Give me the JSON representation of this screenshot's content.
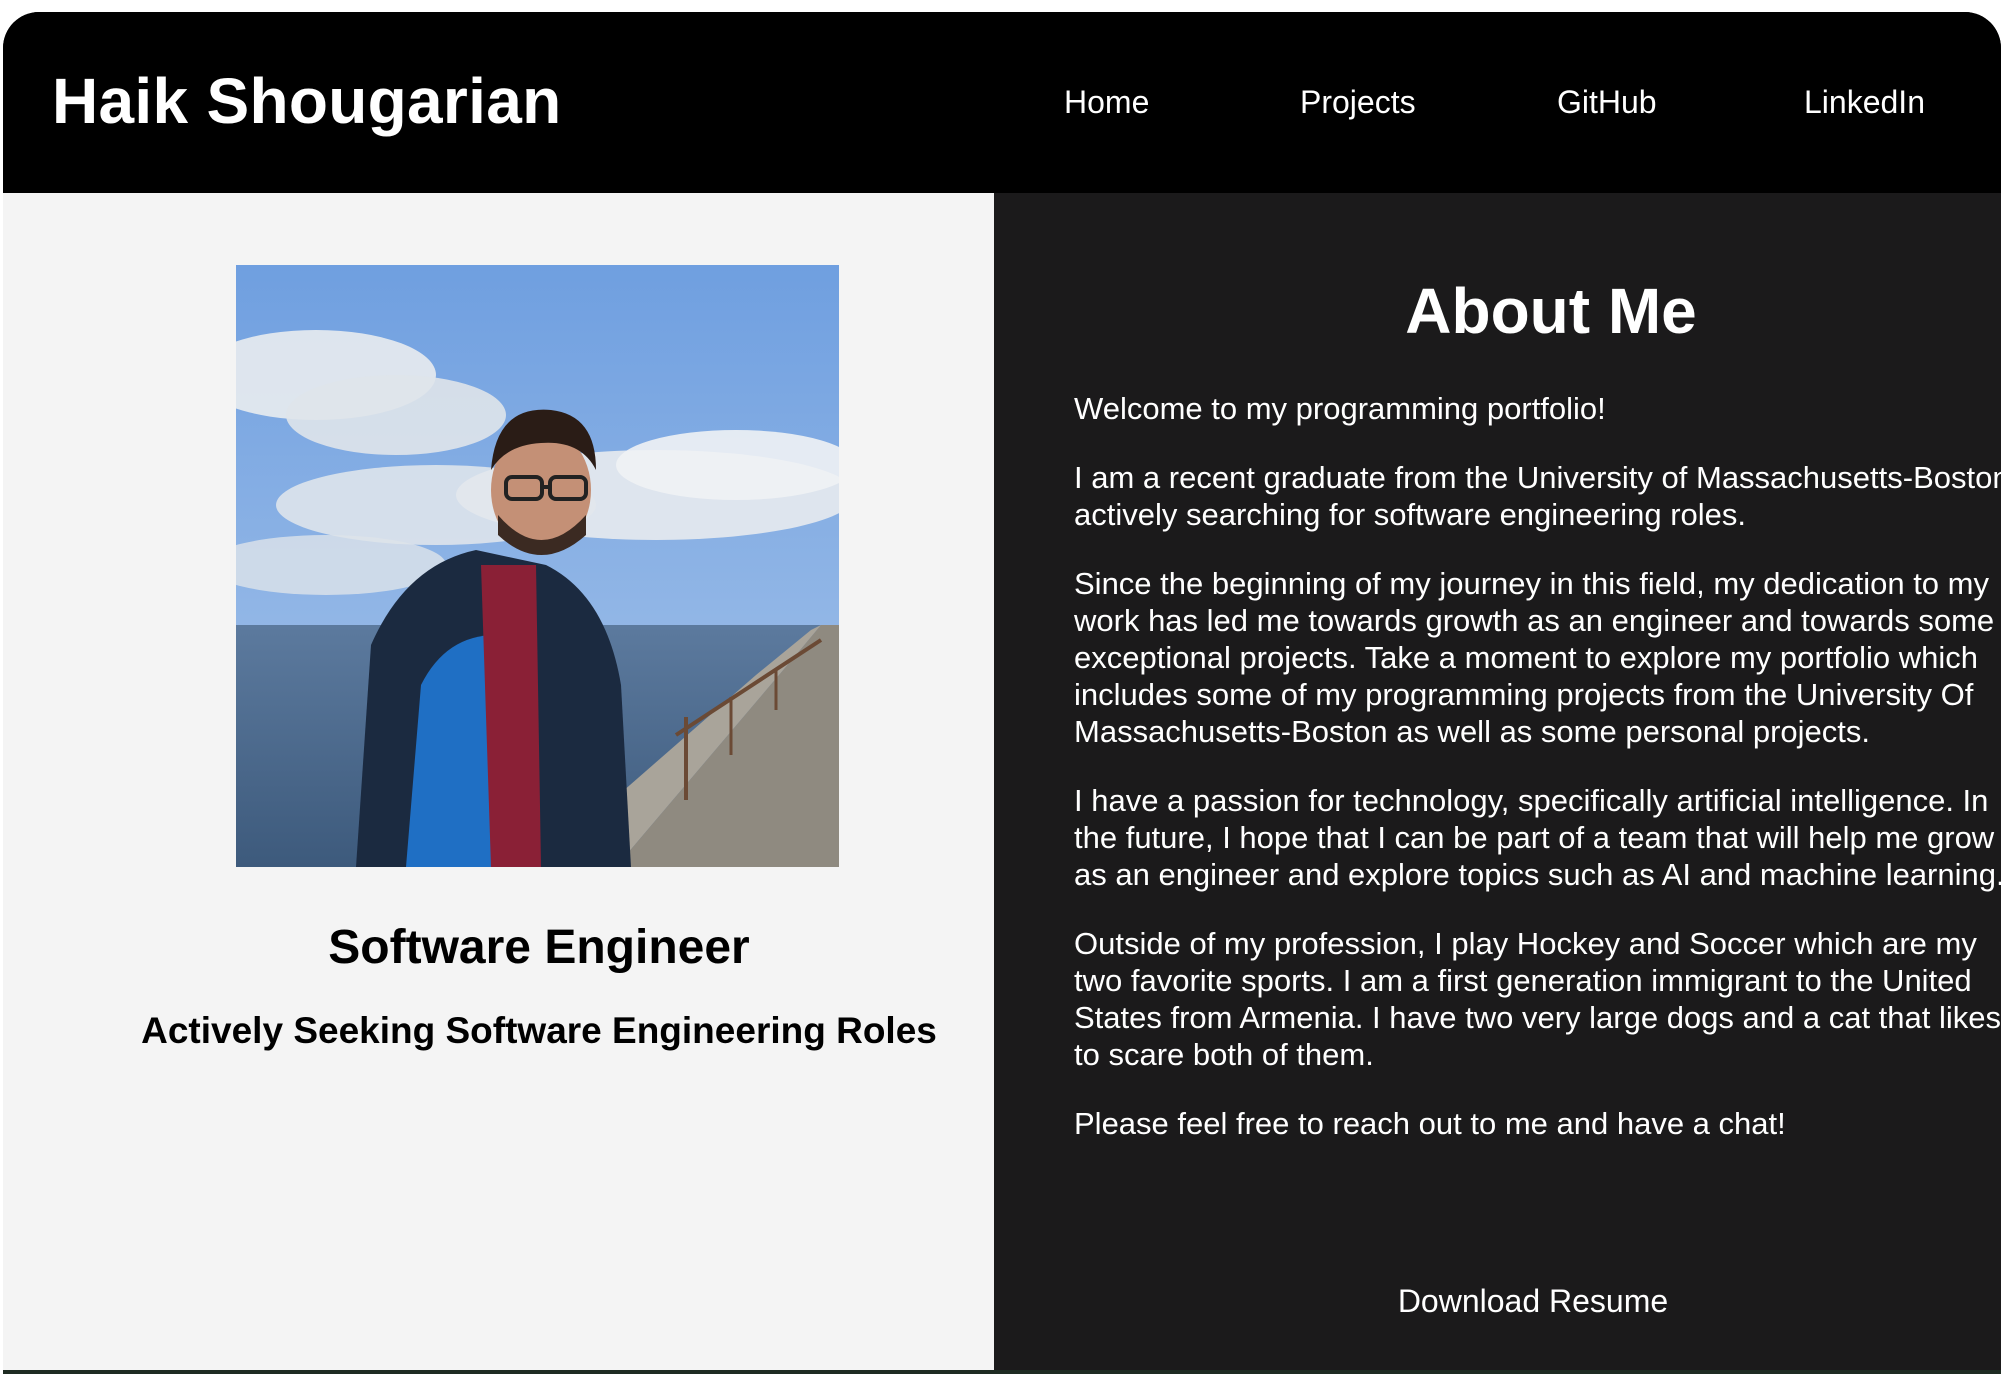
{
  "header": {
    "brand": "Haik Shougarian",
    "nav": [
      "Home",
      "Projects",
      "GitHub",
      "LinkedIn"
    ]
  },
  "profile": {
    "role": "Software Engineer",
    "status": "Actively Seeking Software Engineering Roles"
  },
  "about": {
    "title": "About Me",
    "paragraphs": [
      "Welcome to my programming portfolio!",
      "I am a recent graduate from the University of Massachusetts-Boston actively searching for software engineering roles.",
      "Since the beginning of my journey in this field, my dedication to my work has led me towards growth as an engineer and towards some exceptional projects. Take a moment to explore my portfolio which includes some of my programming projects from the University Of Massachusetts-Boston as well as some personal projects.",
      "I have a passion for technology, specifically artificial intelligence. In the future, I hope that I can be part of a team that will help me grow as an engineer and explore topics such as AI and machine learning.",
      "Outside of my profession, I play Hockey and Soccer which are my two favorite sports. I am a first generation immigrant to the United States from Armenia. I have two very large dogs and a cat that likes to scare both of them.",
      "Please feel free to reach out to me and have a chat!"
    ],
    "download_label": "Download Resume"
  },
  "colors": {
    "header_bg": "#000000",
    "left_panel_bg": "#f4f4f4",
    "right_panel_bg": "#1b1a1b",
    "text_light": "#ffffff",
    "text_dark": "#000000"
  }
}
